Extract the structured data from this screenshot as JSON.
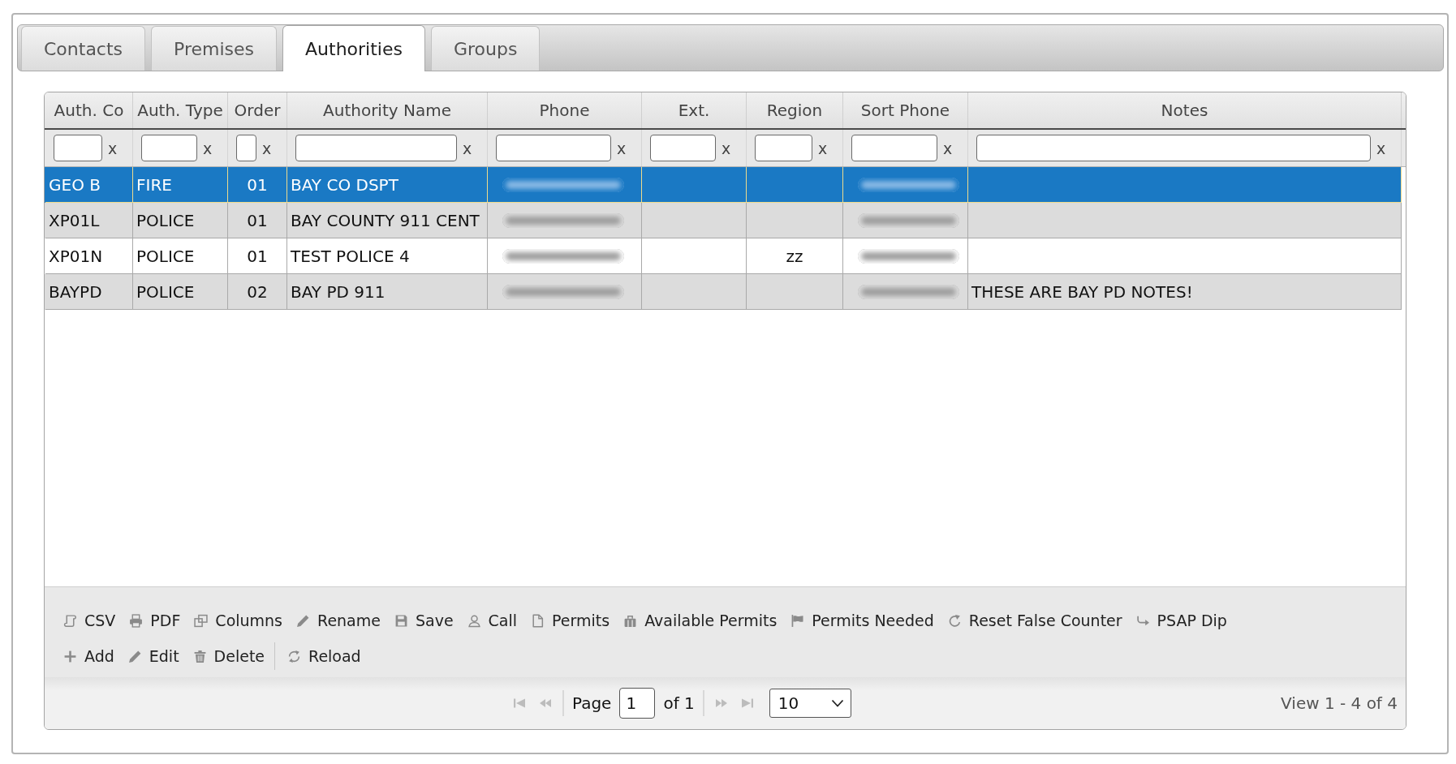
{
  "tabs": [
    {
      "label": "Contacts",
      "selected": false
    },
    {
      "label": "Premises",
      "selected": false
    },
    {
      "label": "Authorities",
      "selected": true
    },
    {
      "label": "Groups",
      "selected": false
    }
  ],
  "columns": [
    {
      "label": "Auth. Co",
      "clear": "x"
    },
    {
      "label": "Auth. Type",
      "clear": "x"
    },
    {
      "label": "Order",
      "clear": "x"
    },
    {
      "label": "Authority Name",
      "clear": "x"
    },
    {
      "label": "Phone",
      "clear": "x"
    },
    {
      "label": "Ext.",
      "clear": "x"
    },
    {
      "label": "Region",
      "clear": "x"
    },
    {
      "label": "Sort Phone",
      "clear": "x"
    },
    {
      "label": "Notes",
      "clear": "x"
    }
  ],
  "rows": [
    {
      "selected": true,
      "auth_code": "GEO B",
      "auth_type": "FIRE",
      "order": "01",
      "authority_name": "BAY CO DSPT",
      "phone": {
        "blurred": true
      },
      "sort_phone": {
        "blurred": true
      }
    },
    {
      "selected": false,
      "auth_code": "XP01L",
      "auth_type": "POLICE",
      "order": "01",
      "authority_name": "BAY COUNTY 911 CENT",
      "phone": {
        "blurred": true
      },
      "sort_phone": {
        "blurred": true
      }
    },
    {
      "selected": false,
      "auth_code": "XP01N",
      "auth_type": "POLICE",
      "order": "01",
      "authority_name": "TEST POLICE 4",
      "phone": {
        "blurred": true
      },
      "region": "zz",
      "sort_phone": {
        "blurred": true
      }
    },
    {
      "selected": false,
      "auth_code": "BAYPD",
      "auth_type": "POLICE",
      "order": "02",
      "authority_name": "BAY PD 911",
      "phone": {
        "blurred": true
      },
      "sort_phone": {
        "blurred": true
      },
      "notes": "THESE ARE BAY PD NOTES!"
    }
  ],
  "toolbar": {
    "rows": [
      [
        [
          "CSV",
          "PDF",
          "Columns",
          "Rename",
          "Save",
          "Call",
          "Permits",
          "Available Permits",
          "Permits Needed",
          "Reset False Counter",
          "PSAP Dip"
        ]
      ],
      [
        [
          "Add",
          "Edit",
          "Delete"
        ],
        [
          "Reload"
        ]
      ]
    ]
  },
  "pager": {
    "first_page": {
      "disabled": true
    },
    "previous_page": {
      "disabled": true
    },
    "page_label": "Page",
    "page": "1",
    "page_count": "of 1",
    "next_page": {
      "disabled": true
    },
    "last_page": {
      "disabled": true
    },
    "page_size": "10",
    "record_info": "View 1 - 4 of 4"
  }
}
